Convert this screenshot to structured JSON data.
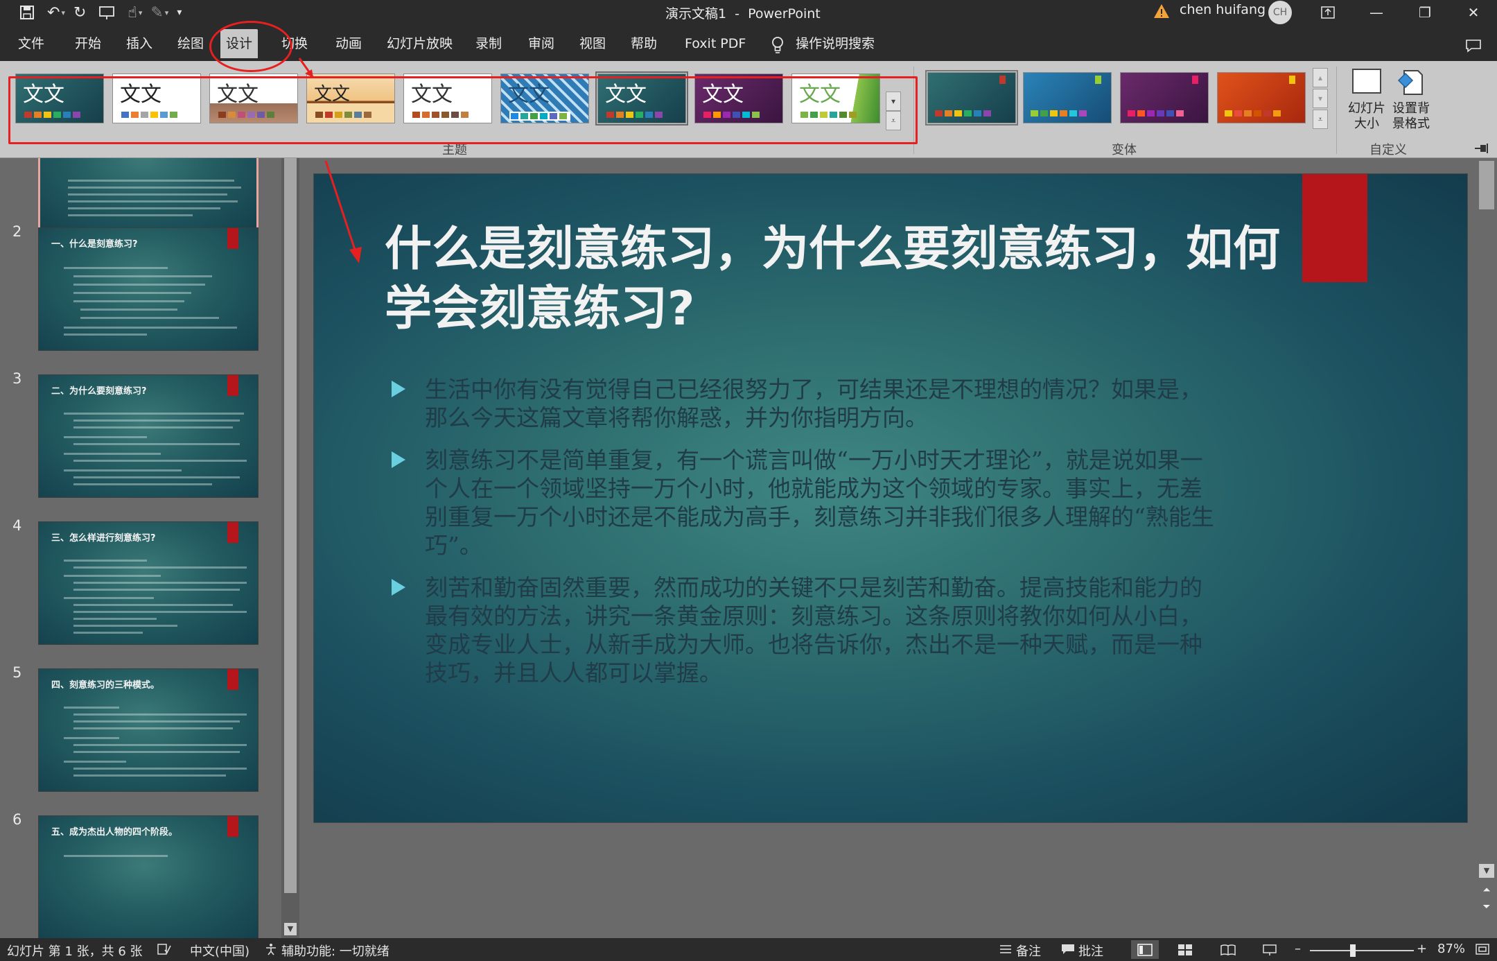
{
  "window": {
    "title": "演示文稿1  -  PowerPoint",
    "user_name": "chen huifang",
    "avatar_initials": "CH"
  },
  "menu": {
    "tabs": [
      "文件",
      "开始",
      "插入",
      "绘图",
      "设计",
      "切换",
      "动画",
      "幻灯片放映",
      "录制",
      "审阅",
      "视图",
      "帮助",
      "Foxit PDF"
    ],
    "active_tab": "设计",
    "tell_me": "操作说明搜索"
  },
  "ribbon": {
    "themes_group_label": "主题",
    "variants_group_label": "变体",
    "customize_group_label": "自定义",
    "themes": [
      {
        "text": "文文"
      },
      {
        "text": "文文"
      },
      {
        "text": "文文"
      },
      {
        "text": "文文"
      },
      {
        "text": "文文"
      },
      {
        "text": "文文"
      },
      {
        "text": "文文"
      },
      {
        "text": "文文"
      },
      {
        "text": "文文"
      }
    ],
    "slide_size_label": "幻灯片\n大小",
    "format_background_label": "设置背\n景格式"
  },
  "slides_panel": {
    "thumbnails": [
      {
        "number": "",
        "title": ""
      },
      {
        "number": "2",
        "title": "一、什么是刻意练习?"
      },
      {
        "number": "3",
        "title": "二、为什么要刻意练习?"
      },
      {
        "number": "4",
        "title": "三、怎么样进行刻意练习?"
      },
      {
        "number": "5",
        "title": "四、刻意练习的三种模式。"
      },
      {
        "number": "6",
        "title": "五、成为杰出人物的四个阶段。"
      }
    ]
  },
  "slide": {
    "title": "什么是刻意练习，为什么要刻意练习，如何学会刻意练习?",
    "bullets": [
      "生活中你有没有觉得自己已经很努力了，可结果还是不理想的情况？如果是，那么今天这篇文章将帮你解惑，并为你指明方向。",
      "刻意练习不是简单重复，有一个谎言叫做“一万小时天才理论”，就是说如果一个人在一个领域坚持一万个小时，他就能成为这个领域的专家。事实上，无差别重复一万个小时还是不能成为高手，刻意练习并非我们很多人理解的“熟能生巧”。",
      "刻苦和勤奋固然重要，然而成功的关键不只是刻苦和勤奋。提高技能和能力的最有效的方法，讲究一条黄金原则：刻意练习。这条原则将教你如何从小白，变成专业人士，从新手成为大师。也将告诉你，杰出不是一种天赋，而是一种技巧，并且人人都可以掌握。"
    ]
  },
  "status": {
    "slide_info": "幻灯片 第 1 张，共 6 张",
    "language": "中文(中国)",
    "accessibility": "辅助功能: 一切就绪",
    "notes": "备注",
    "comments": "批注",
    "zoom": "87%"
  },
  "colors": {
    "accent_red": "#e62020",
    "slide_red_tab": "#b4161b",
    "bullet_triangle": "#6ad0e0"
  }
}
